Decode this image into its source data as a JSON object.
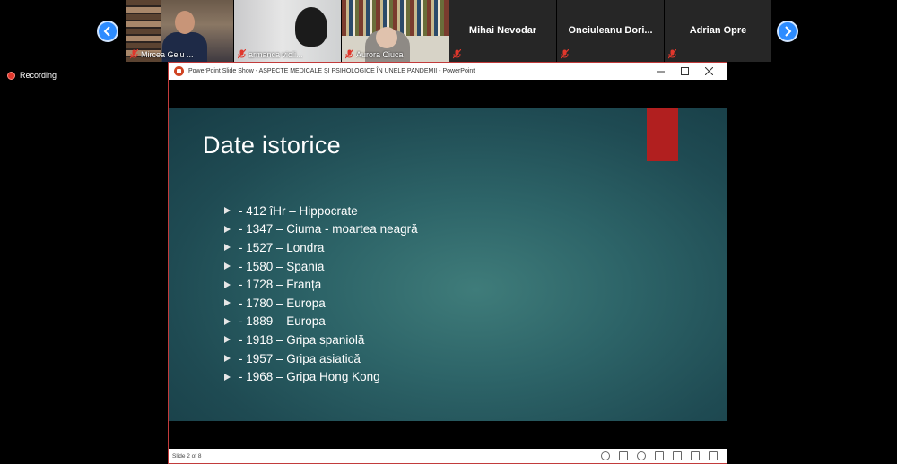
{
  "participants": [
    {
      "name": "Mircea Gelu ...",
      "video": true
    },
    {
      "name": "armanca violi...",
      "video": true
    },
    {
      "name": "Aurora Ciuca",
      "video": true
    },
    {
      "name": "Mihai Nevodar",
      "video": false
    },
    {
      "name": "Onciuleanu Dori...",
      "video": false
    },
    {
      "name": "Adrian Opre",
      "video": false
    }
  ],
  "recording": {
    "label": "Recording"
  },
  "ppt": {
    "window_title": "PowerPoint Slide Show  -  ASPECTE MEDICALE ȘI PSIHOLOGICE ÎN UNELE PANDEMII  -  PowerPoint",
    "slide_title": "Date istorice",
    "items": [
      "- 412 îHr – Hippocrate",
      "- 1347 – Ciuma - moartea neagră",
      "- 1527 – Londra",
      "- 1580 – Spania",
      "- 1728 – Franța",
      "- 1780 – Europa",
      "- 1889 – Europa",
      "- 1918 – Gripa spaniolă",
      "- 1957 – Gripa asiatică",
      "- 1968 – Gripa Hong Kong"
    ],
    "status": "Slide 2 of 8"
  },
  "colors": {
    "accent": "#2d8cff",
    "slide_accent": "#b11f1f",
    "mute": "#e0372c"
  }
}
